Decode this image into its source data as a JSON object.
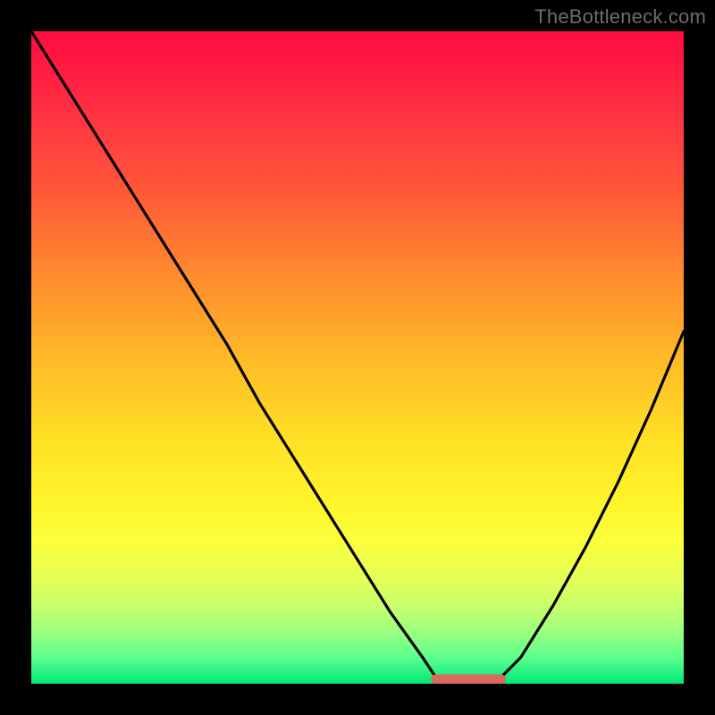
{
  "watermark": "TheBottleneck.com",
  "colors": {
    "frame": "#000000",
    "curve": "#000000",
    "flat_segment": "#d86a5e",
    "gradient_stops": [
      "#ff0b41",
      "#ff2f42",
      "#ff5a38",
      "#ff8d2e",
      "#ffb927",
      "#ffdf25",
      "#fff42a",
      "#fbff3c",
      "#e8ff52",
      "#c9ff6b",
      "#9dff7f",
      "#5bff8e",
      "#00e878"
    ]
  },
  "chart_data": {
    "type": "line",
    "title": "",
    "xlabel": "",
    "ylabel": "",
    "xlim": [
      0,
      100
    ],
    "ylim": [
      0,
      100
    ],
    "grid": false,
    "legend": false,
    "x": [
      0,
      5,
      10,
      15,
      20,
      25,
      30,
      35,
      40,
      45,
      50,
      55,
      60,
      62,
      64,
      70,
      72,
      75,
      80,
      85,
      90,
      95,
      100
    ],
    "values": [
      100,
      92,
      84,
      76,
      68,
      60,
      52,
      43,
      35,
      27,
      19,
      11,
      4,
      1,
      0,
      0,
      1,
      4,
      12,
      21,
      31,
      42,
      54
    ],
    "flat_segment": {
      "x_start": 62,
      "x_end": 72,
      "y": 0
    }
  }
}
